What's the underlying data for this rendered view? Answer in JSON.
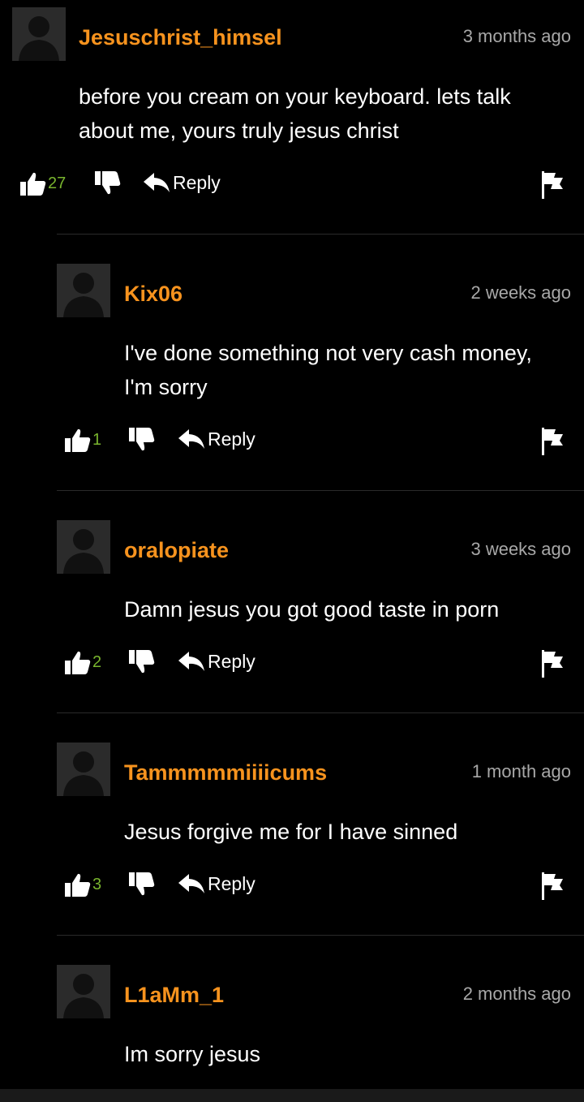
{
  "comments": [
    {
      "username": "Jesuschrist_himsel",
      "time": "3 months ago",
      "text_lines": [
        "before you cream on your keyboard. lets talk",
        "about me, yours truly jesus christ"
      ],
      "likes": "27",
      "reply_label": "Reply"
    },
    {
      "username": "Kix06",
      "time": "2 weeks ago",
      "text_lines": [
        "I've done something not very cash money,",
        "I'm sorry"
      ],
      "likes": "1",
      "reply_label": "Reply"
    },
    {
      "username": "oralopiate",
      "time": "3 weeks ago",
      "text_lines": [
        "Damn jesus you got good taste in porn"
      ],
      "likes": "2",
      "reply_label": "Reply"
    },
    {
      "username": "Tammmmmiiiicums",
      "time": "1 month ago",
      "text_lines": [
        "Jesus forgive me for I have sinned"
      ],
      "likes": "3",
      "reply_label": "Reply"
    },
    {
      "username": "L1aMm_1",
      "time": "2 months ago",
      "text_lines": [
        "Im sorry jesus"
      ]
    }
  ],
  "colors": {
    "username": "#f7931e",
    "likes": "#79b52e",
    "time": "#a8a8a8",
    "background": "#000000"
  },
  "icons": {
    "avatar": "default-avatar-icon",
    "like": "thumbs-up-icon",
    "dislike": "thumbs-down-icon",
    "reply": "reply-arrow-icon",
    "flag": "flag-icon"
  }
}
